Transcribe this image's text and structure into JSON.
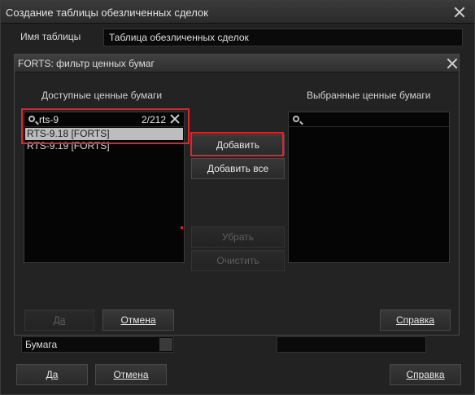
{
  "outer": {
    "title": "Создание таблицы обезличенных сделок",
    "name_label": "Имя таблицы",
    "name_value": "Таблица обезличенных сделок",
    "field1_value": "Бумага",
    "buttons": {
      "ok": "Да",
      "cancel": "Отмена",
      "help": "Справка"
    }
  },
  "dialog": {
    "title": "FORTS: фильтр ценных бумаг",
    "available_header": "Доступные ценные бумаги",
    "selected_header": "Выбранные ценные бумаги",
    "search": {
      "value": "rts-9",
      "count": "2/212"
    },
    "available_items": [
      {
        "label": "RTS-9.18 [FORTS]",
        "selected": true
      },
      {
        "label": "RTS-9.19 [FORTS]",
        "selected": false
      }
    ],
    "selected_search": {
      "value": ""
    },
    "buttons": {
      "add": "Добавить",
      "add_all": "Добавить все",
      "remove": "Убрать",
      "clear": "Очистить",
      "ok": "Да",
      "cancel": "Отмена",
      "help": "Справка"
    }
  },
  "colors": {
    "highlight": "#e0242b",
    "selection": "#bdbdbd"
  }
}
